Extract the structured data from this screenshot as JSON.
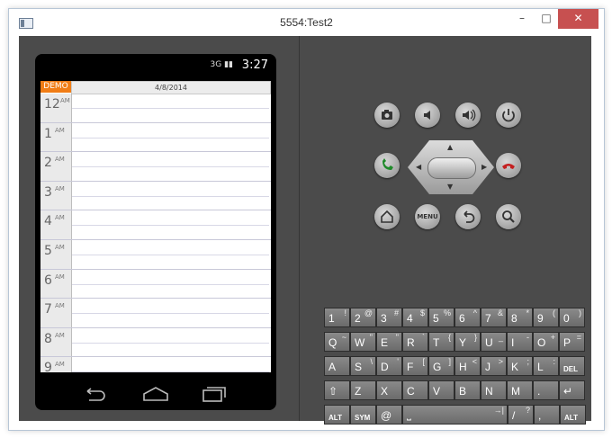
{
  "window": {
    "title": "5554:Test2",
    "minimize_label": "–",
    "maximize_label": "□",
    "close_label": "✕"
  },
  "status": {
    "net": "3G",
    "time": "3:27"
  },
  "calendar": {
    "demo_label": "DEMO",
    "date": "4/8/2014",
    "hours": [
      {
        "n": "12",
        "s": "AM"
      },
      {
        "n": "1",
        "s": "AM"
      },
      {
        "n": "2",
        "s": "AM"
      },
      {
        "n": "3",
        "s": "AM"
      },
      {
        "n": "4",
        "s": "AM"
      },
      {
        "n": "5",
        "s": "AM"
      },
      {
        "n": "6",
        "s": "AM"
      },
      {
        "n": "7",
        "s": "AM"
      },
      {
        "n": "8",
        "s": "AM"
      },
      {
        "n": "9",
        "s": "AM"
      }
    ]
  },
  "navbar": {
    "back_icon": "back-icon",
    "home_icon": "home-icon",
    "recents_icon": "recents-icon"
  },
  "controls": {
    "menu_label": "MENU"
  },
  "keyboard": {
    "row1": [
      {
        "m": "1",
        "a": "!"
      },
      {
        "m": "2",
        "a": "@"
      },
      {
        "m": "3",
        "a": "#"
      },
      {
        "m": "4",
        "a": "$"
      },
      {
        "m": "5",
        "a": "%"
      },
      {
        "m": "6",
        "a": "^"
      },
      {
        "m": "7",
        "a": "&"
      },
      {
        "m": "8",
        "a": "*"
      },
      {
        "m": "9",
        "a": "("
      },
      {
        "m": "0",
        "a": ")"
      }
    ],
    "row2": [
      {
        "m": "Q",
        "a": "~"
      },
      {
        "m": "W",
        "a": "\""
      },
      {
        "m": "E",
        "a": "\""
      },
      {
        "m": "R",
        "a": "`"
      },
      {
        "m": "T",
        "a": "{"
      },
      {
        "m": "Y",
        "a": "}"
      },
      {
        "m": "U",
        "a": "_"
      },
      {
        "m": "I",
        "a": "-"
      },
      {
        "m": "O",
        "a": "+"
      },
      {
        "m": "P",
        "a": "="
      }
    ],
    "row3": [
      {
        "m": "A",
        "a": ""
      },
      {
        "m": "S",
        "a": "\\"
      },
      {
        "m": "D",
        "a": "'"
      },
      {
        "m": "F",
        "a": "["
      },
      {
        "m": "G",
        "a": "]"
      },
      {
        "m": "H",
        "a": "<"
      },
      {
        "m": "J",
        "a": ">"
      },
      {
        "m": "K",
        "a": ";"
      },
      {
        "m": "L",
        "a": ":"
      },
      {
        "m": "DEL",
        "a": ""
      }
    ],
    "row4": [
      {
        "m": "⇧",
        "a": ""
      },
      {
        "m": "Z",
        "a": ""
      },
      {
        "m": "X",
        "a": ""
      },
      {
        "m": "C",
        "a": ""
      },
      {
        "m": "V",
        "a": ""
      },
      {
        "m": "B",
        "a": ""
      },
      {
        "m": "N",
        "a": ""
      },
      {
        "m": "M",
        "a": ""
      },
      {
        "m": ".",
        "a": ""
      },
      {
        "m": "↵",
        "a": ""
      }
    ],
    "row5": [
      {
        "m": "ALT",
        "a": ""
      },
      {
        "m": "SYM",
        "a": ""
      },
      {
        "m": "@",
        "a": ""
      },
      {
        "m": "⎵",
        "a": "→|"
      },
      {
        "m": "/",
        "a": "?"
      },
      {
        "m": ",",
        "a": ""
      },
      {
        "m": "ALT",
        "a": ""
      }
    ]
  }
}
